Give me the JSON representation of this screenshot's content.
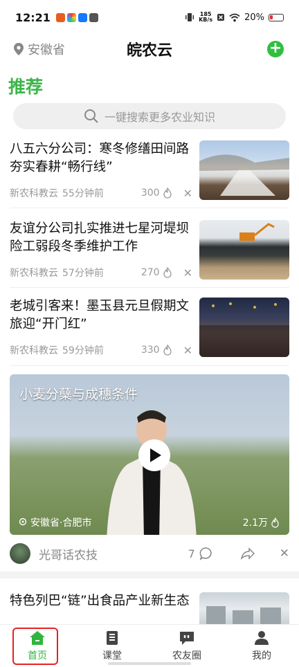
{
  "status": {
    "time": "12:21",
    "net_rate": "185",
    "net_unit": "KB/s",
    "battery": "20%"
  },
  "header": {
    "location": "安徽省",
    "title": "皖农云",
    "add_label": "+"
  },
  "section_title": "推荐",
  "search": {
    "placeholder": "一键搜索更多农业知识"
  },
  "news": [
    {
      "title": "八五六分公司：寒冬修缮田间路 夯实春耕“畅行线”",
      "source": "新农科教云",
      "time": "55分钟前",
      "count": "300"
    },
    {
      "title": "友谊分公司扎实推进七星河堤坝险工弱段冬季维护工作",
      "source": "新农科教云",
      "time": "57分钟前",
      "count": "270"
    },
    {
      "title": "老城引客来！墨玉县元旦假期文旅迎“开门红”",
      "source": "新农科教云",
      "time": "59分钟前",
      "count": "330"
    }
  ],
  "video": {
    "title": "小麦分蘖与成穗条件",
    "location": "安徽省·合肥市",
    "views": "2.1万",
    "author": "光哥话农技",
    "comments": "7"
  },
  "news5": {
    "title": "特色列巴“链”出食品产业新生态"
  },
  "tabs": [
    {
      "label": "首页"
    },
    {
      "label": "课堂"
    },
    {
      "label": "农友圈"
    },
    {
      "label": "我的"
    }
  ],
  "colors": {
    "accent": "#2fb53e",
    "highlight_box": "#e82121"
  }
}
